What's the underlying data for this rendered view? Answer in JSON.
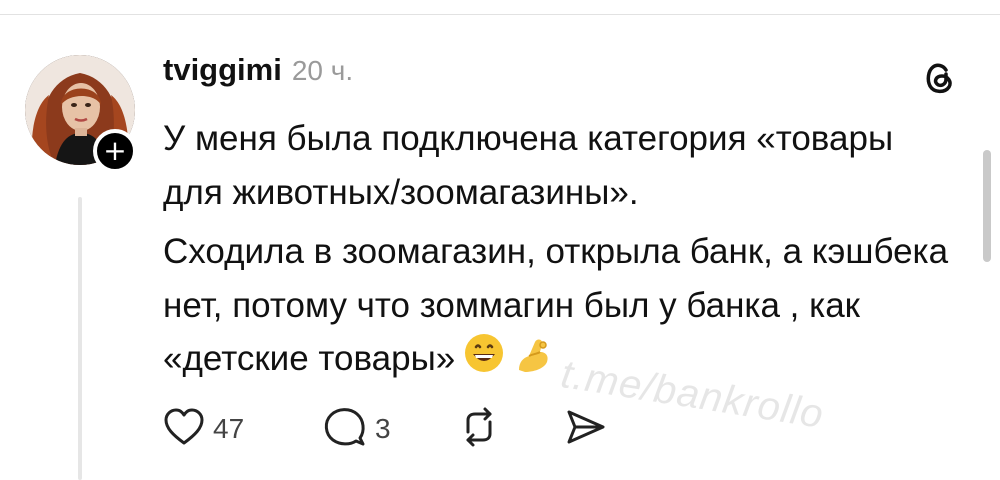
{
  "post": {
    "username": "tviggimi",
    "timestamp": "20 ч.",
    "paragraph1": "У меня была подключена категория «товары для животных/зоомагазины».",
    "paragraph2": "Сходила в зоомагазин, открыла банк, а кэшбека нет, потому что зоммагин был у банка , как «детские товары»",
    "emojis": [
      "grinning-face-emoji",
      "pinching-hand-emoji"
    ]
  },
  "actions": {
    "likes": "47",
    "replies": "3"
  },
  "watermark": "t.me/bankrollo",
  "icons": {
    "like": "heart-icon",
    "reply": "speech-bubble-icon",
    "repost": "repost-icon",
    "share": "send-icon",
    "logo": "threads-logo-icon",
    "follow": "plus-icon"
  },
  "colors": {
    "text": "#111111",
    "muted": "#9a9a9a",
    "badge": "#000000",
    "thread_line": "#e6e6e6"
  }
}
